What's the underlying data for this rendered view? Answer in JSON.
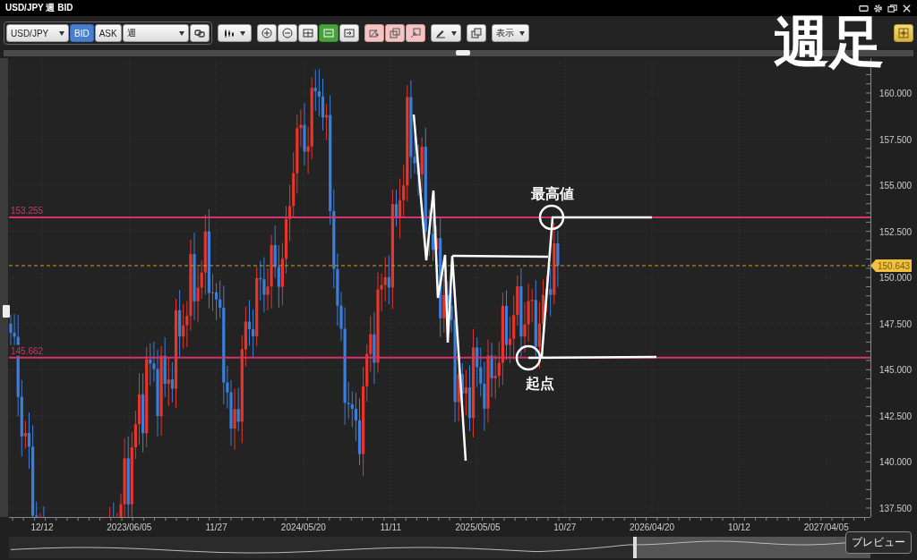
{
  "window": {
    "title": "USD/JPY 週 BID"
  },
  "overlay_title": "週足",
  "toolbar": {
    "symbol": "USD/JPY",
    "price_sides": [
      {
        "label": "BID",
        "selected": true
      },
      {
        "label": "ASK",
        "selected": false
      }
    ],
    "period": "週",
    "tools": [
      {
        "kind": "zoom-in",
        "selected": false
      },
      {
        "kind": "zoom-out",
        "selected": false
      },
      {
        "kind": "fit",
        "selected": false
      },
      {
        "kind": "scroll",
        "selected": true
      },
      {
        "kind": "jump",
        "selected": false
      }
    ],
    "display_menu": "表示"
  },
  "chart": {
    "y_ticks": [
      "160.000",
      "157.500",
      "155.000",
      "152.500",
      "150.000",
      "147.500",
      "145.000",
      "142.500",
      "140.000",
      "137.500"
    ],
    "x_labels": [
      "12/12",
      "2023/06/05",
      "11/27",
      "2024/05/20",
      "11/11",
      "2025/05/05",
      "10/27",
      "2026/04/20",
      "10/12",
      "2027/04/05"
    ],
    "levels": [
      {
        "label": "153.255"
      },
      {
        "label": "145.662"
      }
    ],
    "current_price": "150.643",
    "annotations": [
      {
        "kind": "peak",
        "label": "最高値"
      },
      {
        "kind": "origin",
        "label": "起点"
      }
    ]
  },
  "navigator": {
    "tooltip": "プレビュー"
  }
}
